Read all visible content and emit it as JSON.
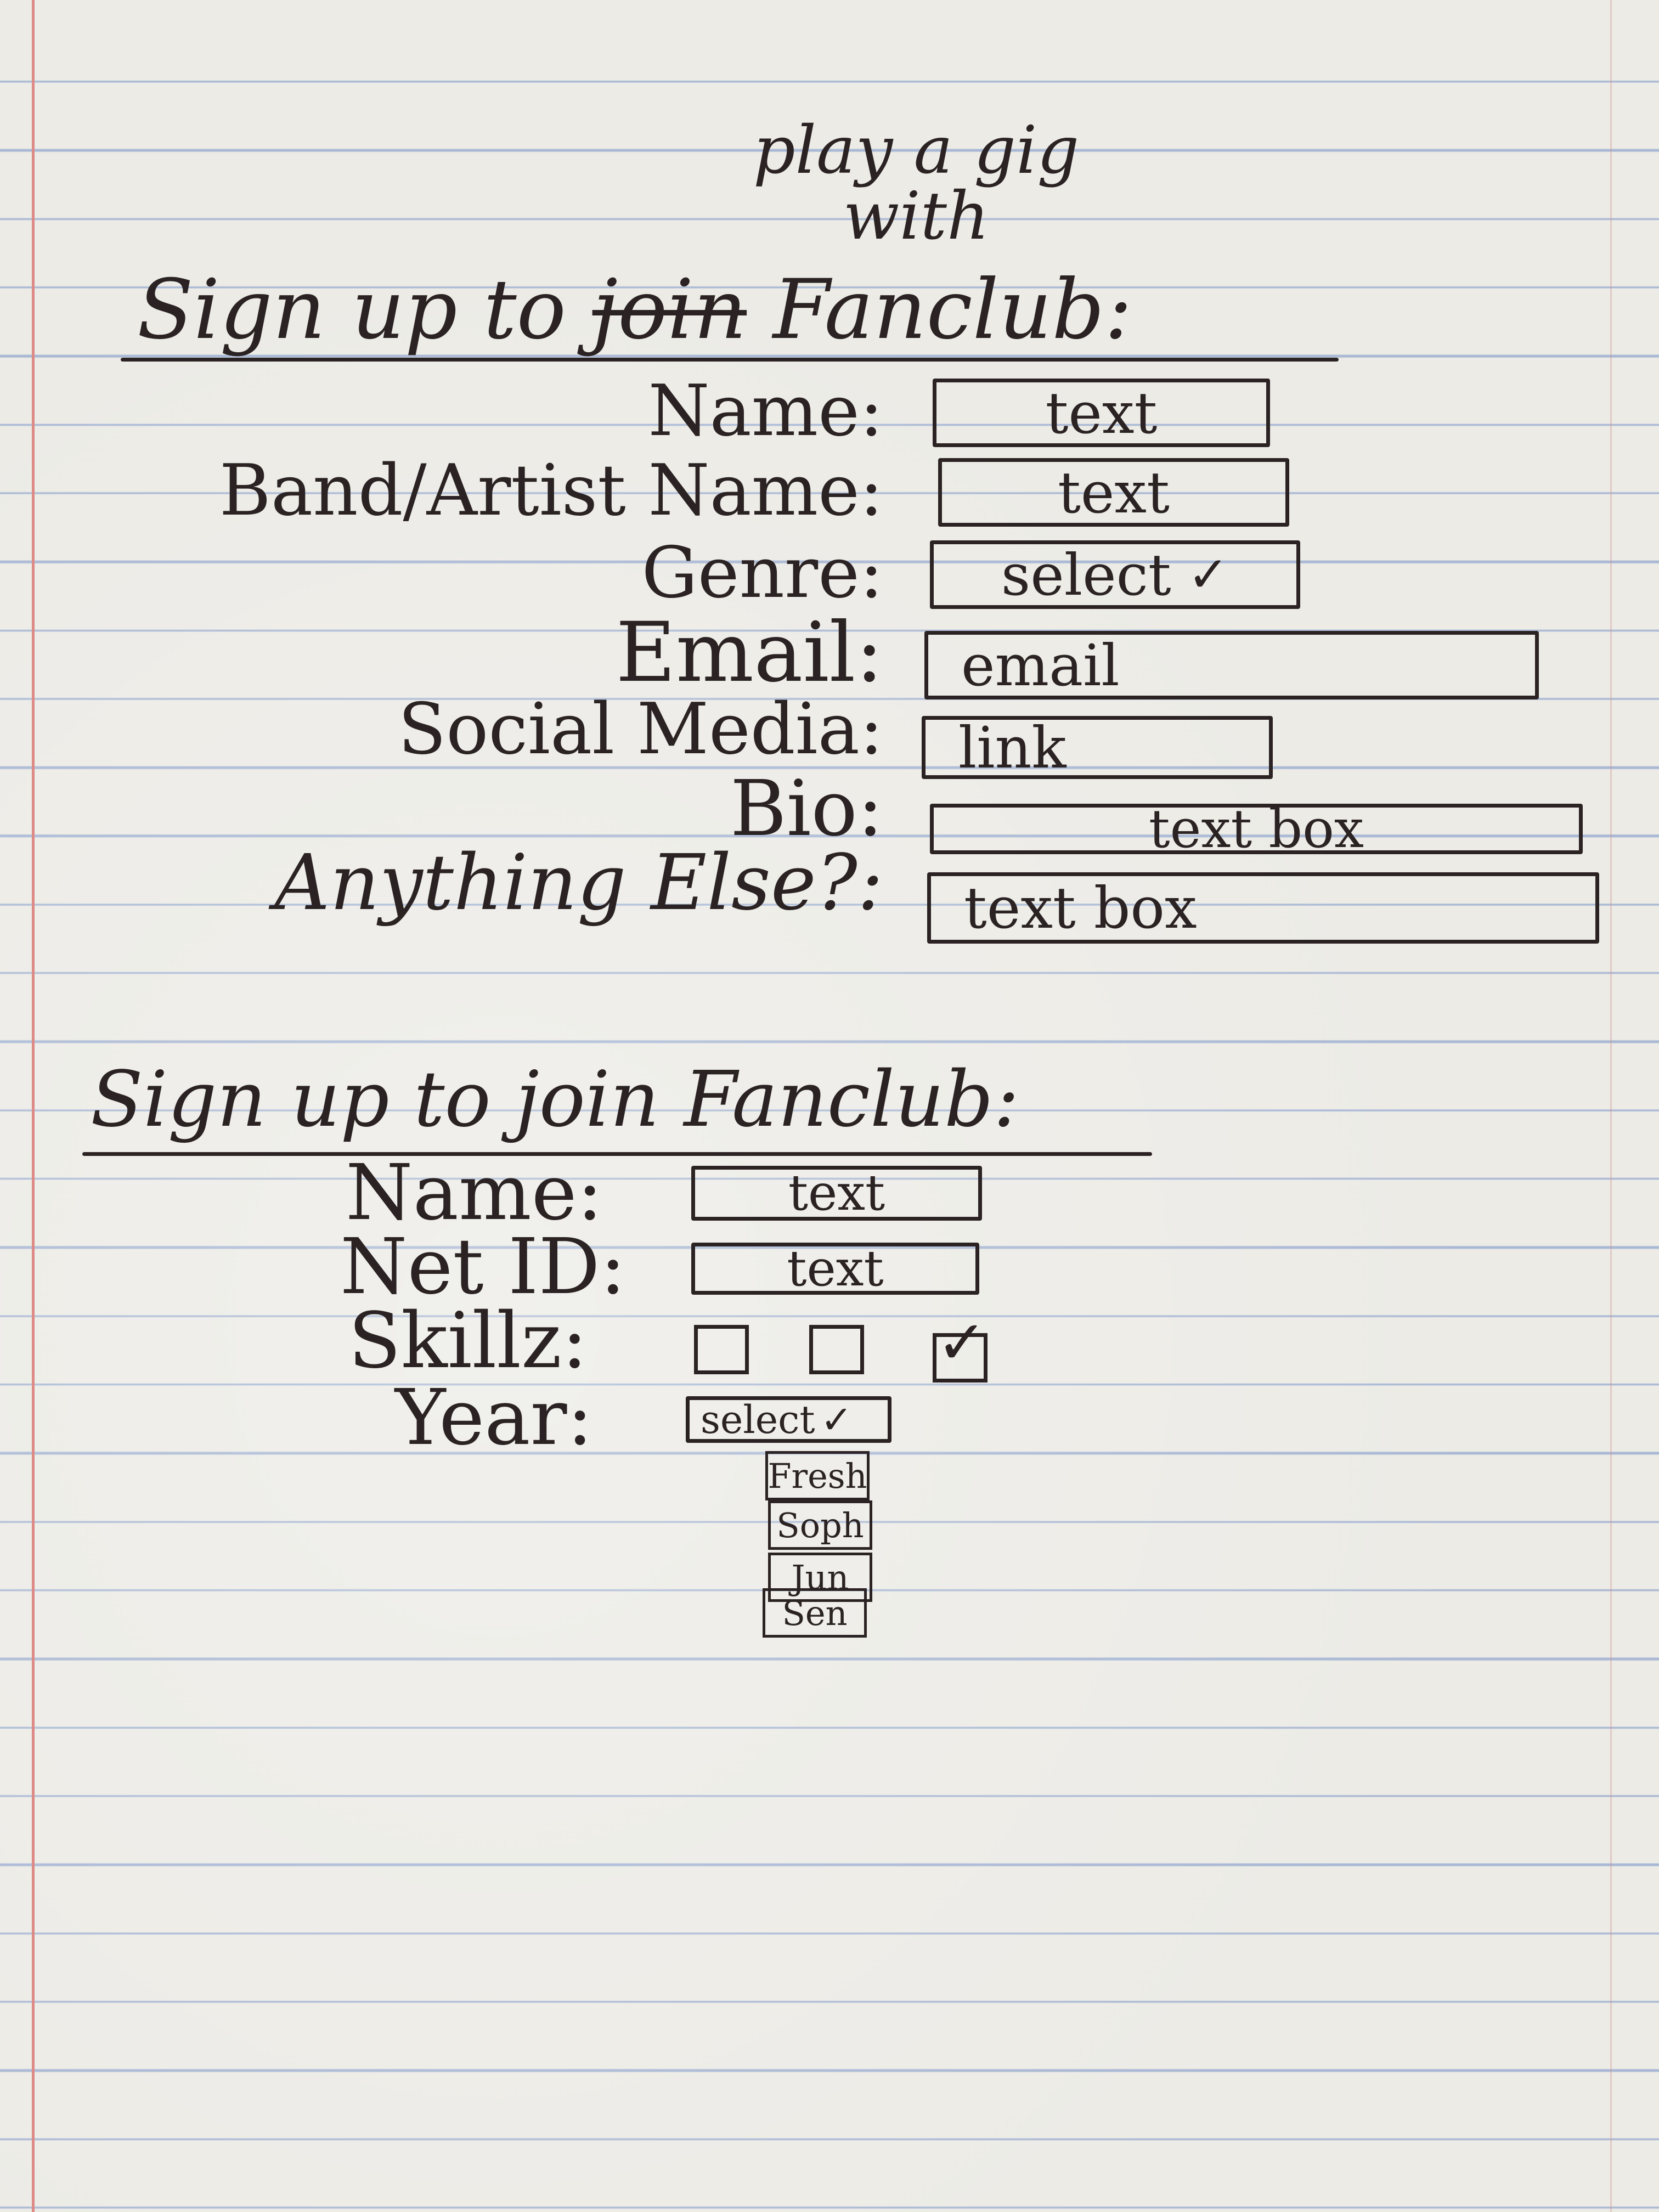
{
  "form1": {
    "insert_text": "play a gig with",
    "title_start": "Sign up to",
    "title_struck": "join",
    "title_end": "Fanclub:",
    "fields": {
      "name_label": "Name:",
      "name_value": "text",
      "band_label": "Band/Artist Name:",
      "band_value": "text",
      "genre_label": "Genre:",
      "genre_value": "select",
      "email_label": "Email:",
      "email_value": "email",
      "social_label": "Social Media:",
      "social_value": "link",
      "bio_label": "Bio:",
      "bio_value": "text box",
      "else_label": "Anything Else?:",
      "else_value": "text box"
    }
  },
  "form2": {
    "title": "Sign up to join Fanclub:",
    "fields": {
      "name_label": "Name:",
      "name_value": "text",
      "netid_label": "Net ID:",
      "netid_value": "text",
      "skillz_label": "Skillz:",
      "skillz_checked": [
        false,
        false,
        true
      ],
      "year_label": "Year:",
      "year_value": "select",
      "year_options": [
        "Fresh",
        "Soph",
        "Jun",
        "Sen"
      ]
    }
  },
  "icons": {
    "dropdown": "chevron-down-icon",
    "checkmark": "check-icon"
  }
}
